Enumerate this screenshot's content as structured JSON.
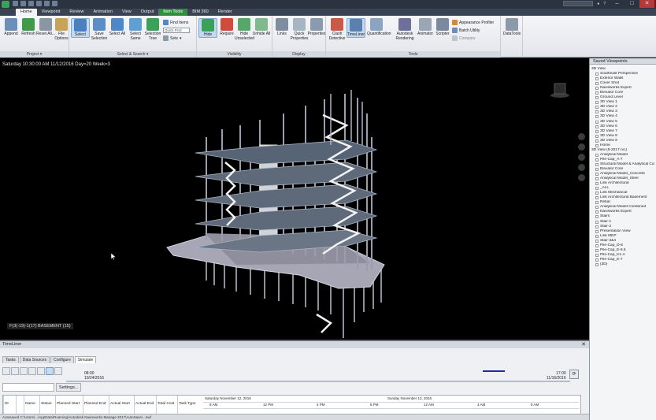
{
  "title_bar": {
    "search_placeholder": "",
    "minimize": "–",
    "maximize": "□",
    "close": "✕"
  },
  "tabs": [
    "Home",
    "Viewpoint",
    "Review",
    "Animation",
    "View",
    "Output",
    "Item Tools",
    "BIM 360",
    "Render"
  ],
  "ribbon": {
    "project": {
      "title": "Project ▾",
      "append": "Append",
      "refresh": "Refresh",
      "reset_all": "Reset All...",
      "file_options": "File Options"
    },
    "select_search": {
      "title": "Select & Search ▾",
      "select": "Select",
      "save_selection": "Save Selection",
      "select_all": "Select All",
      "select_same": "Select Same",
      "selection_tree": "Selection Tree",
      "find_items": "Find Items",
      "quick_find_placeholder": "Quick Find",
      "sets": "Sets"
    },
    "visibility": {
      "title": "Visibility",
      "hide": "Hide",
      "require": "Require",
      "hide_unselected": "Hide Unselected",
      "unhide_all": "Unhide All"
    },
    "display": {
      "title": "Display",
      "links": "Links",
      "quick_properties": "Quick Properties",
      "properties": "Properties"
    },
    "tools": {
      "title": "Tools",
      "clash_detective": "Clash Detective",
      "timeliner": "TimeLiner",
      "quantification": "Quantification",
      "autodesk_rendering": "Autodesk Rendering",
      "animator": "Animator",
      "scripter": "Scripter",
      "appearance_profiler": "Appearance Profiler",
      "batch_utility": "Batch Utility",
      "compare": "Compare",
      "datatools": "DataTools"
    }
  },
  "viewport": {
    "overlay": "Saturday 10:30:00 AM 11/12/2016 Day=20 Week=3",
    "status": "F(3(-19)-1(17)  BASEMENT (15)"
  },
  "saved_viewpoints": {
    "title": "Saved Viewpoints",
    "items": [
      {
        "label": "3D View",
        "level": 0
      },
      {
        "label": "Southeast Perspective",
        "level": 1
      },
      {
        "label": "Exterior Walls",
        "level": 1
      },
      {
        "label": "Cover Shot",
        "level": 1
      },
      {
        "label": "Navisworks Expert",
        "level": 1
      },
      {
        "label": "Elevator Core",
        "level": 1
      },
      {
        "label": "Ground Level",
        "level": 1
      },
      {
        "label": "3D View 1",
        "level": 1
      },
      {
        "label": "3D View 2",
        "level": 1
      },
      {
        "label": "3D View 3",
        "level": 1
      },
      {
        "label": "3D View 4",
        "level": 1
      },
      {
        "label": "3D View 5",
        "level": 1
      },
      {
        "label": "3D View 6",
        "level": 1
      },
      {
        "label": "3D View 7",
        "level": 1
      },
      {
        "label": "3D View 8",
        "level": 1
      },
      {
        "label": "3D View 9",
        "level": 1
      },
      {
        "label": "Home",
        "level": 1
      },
      {
        "label": "3D View (5-2017.rvc)",
        "level": 0
      },
      {
        "label": "Analytical Model",
        "level": 1
      },
      {
        "label": "Pile-Cap_A-7",
        "level": 1
      },
      {
        "label": "Structural Model & Analytical Conn",
        "level": 1
      },
      {
        "label": "Elevator Core",
        "level": 1
      },
      {
        "label": "Analytical Model_Concrete",
        "level": 1
      },
      {
        "label": "Analytical Model_Steel",
        "level": 1
      },
      {
        "label": "Link Architectural",
        "level": 1
      },
      {
        "label": "_ALL",
        "level": 1
      },
      {
        "label": "Link Mechanical",
        "level": 1
      },
      {
        "label": "Link Architectural Basement",
        "level": 1
      },
      {
        "label": "Rebar",
        "level": 1
      },
      {
        "label": "Analytical Model Combined",
        "level": 1
      },
      {
        "label": "Navisworks Expert",
        "level": 1
      },
      {
        "label": "Stairs",
        "level": 1
      },
      {
        "label": "Stair-1",
        "level": 1
      },
      {
        "label": "Stair-2",
        "level": 1
      },
      {
        "label": "Presentation View",
        "level": 1
      },
      {
        "label": "Link MEP",
        "level": 1
      },
      {
        "label": "Stair-3&4",
        "level": 1
      },
      {
        "label": "Pile-Cap_D-8",
        "level": 1
      },
      {
        "label": "Pile-Cap_E-6.5",
        "level": 1
      },
      {
        "label": "Pile-Cap_K1-4",
        "level": 1
      },
      {
        "label": "Pile-Cap_E-7",
        "level": 1
      },
      {
        "label": "{3D}",
        "level": 1
      }
    ]
  },
  "timeliner": {
    "title": "TimeLiner",
    "close": "✕",
    "tabs": [
      "Tasks",
      "Data Sources",
      "Configure",
      "Simulate"
    ],
    "active_tab": "Simulate",
    "start_time": "08:00",
    "start_date": "10/24/2016",
    "end_time": "17:00",
    "end_date": "11/16/2016",
    "settings": "Settings...",
    "columns": [
      "ID",
      "",
      "Name",
      "Status",
      "Planned Start",
      "Planned End",
      "Actual Start",
      "Actual End",
      "Total Cost",
      "Task Type"
    ],
    "gantt_day1": "Saturday November 12, 2016",
    "gantt_day2": "Sunday November 13, 2016",
    "gantt_hours": [
      "8 AM",
      "12 PM",
      "4 PM",
      "8 PM",
      "12 AM",
      "4 AM",
      "8 AM"
    ]
  },
  "statusbar": "Autosaved C:\\Users\\...\\AppData\\Roaming\\Autodesk Navisworks Manage 2017\\AutoSave\\...nwf",
  "colors": {
    "accent": "#2f8f3e",
    "timeline_marker": "#1a2ca8"
  }
}
